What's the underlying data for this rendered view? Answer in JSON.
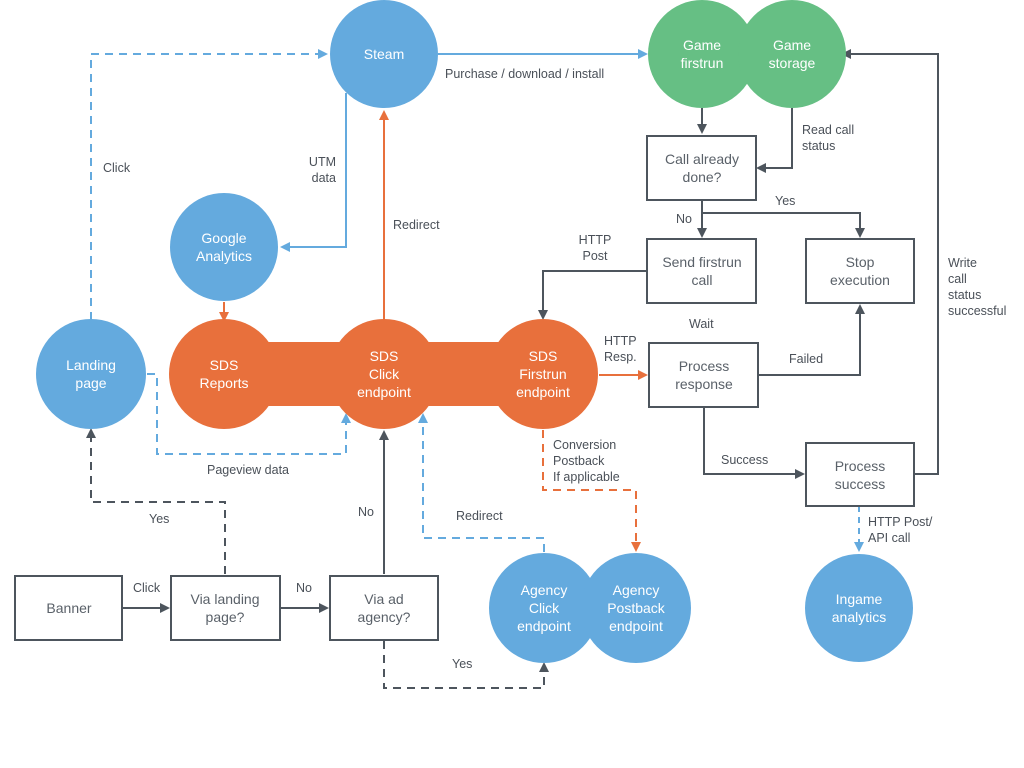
{
  "colors": {
    "blue": "#64aade",
    "orange": "#e8703c",
    "green": "#66bf84",
    "dark": "#4d555d"
  },
  "nodes": {
    "steam": [
      "Steam"
    ],
    "google_analytics": [
      "Google",
      "Analytics"
    ],
    "landing_page": [
      "Landing",
      "page"
    ],
    "sds_reports": [
      "SDS",
      "Reports"
    ],
    "sds_click": [
      "SDS",
      "Click",
      "endpoint"
    ],
    "sds_firstrun": [
      "SDS",
      "Firstrun",
      "endpoint"
    ],
    "game_firstrun": [
      "Game",
      "firstrun"
    ],
    "game_storage": [
      "Game",
      "storage"
    ],
    "agency_click": [
      "Agency",
      "Click",
      "endpoint"
    ],
    "agency_postback": [
      "Agency",
      "Postback",
      "endpoint"
    ],
    "ingame_analytics": [
      "Ingame",
      "analytics"
    ]
  },
  "boxes": {
    "call_already_done": [
      "Call already",
      "done?"
    ],
    "send_firstrun_call": [
      "Send firstrun",
      "call"
    ],
    "stop_execution": [
      "Stop",
      "execution"
    ],
    "process_response": [
      "Process",
      "response"
    ],
    "process_success": [
      "Process",
      "success"
    ],
    "banner": [
      "Banner"
    ],
    "via_landing_page": [
      "Via landing",
      "page?"
    ],
    "via_ad_agency": [
      "Via ad",
      "agency?"
    ]
  },
  "edge_labels": {
    "purchase": [
      "Purchase / download / install"
    ],
    "click_landing": [
      "Click"
    ],
    "utm_data": [
      "UTM",
      "data"
    ],
    "redirect_steam": [
      "Redirect"
    ],
    "read_call_status": [
      "Read call",
      "status"
    ],
    "no_call": [
      "No"
    ],
    "yes_call": [
      "Yes"
    ],
    "http_post": [
      "HTTP",
      "Post"
    ],
    "write_call_status": [
      "Write",
      "call",
      "status",
      "successful"
    ],
    "wait": [
      "Wait"
    ],
    "http_resp": [
      "HTTP",
      "Resp."
    ],
    "failed": [
      "Failed"
    ],
    "pageview_data": [
      "Pageview data"
    ],
    "conversion_postback": [
      "Conversion",
      "Postback",
      "If applicable"
    ],
    "success": [
      "Success"
    ],
    "yes_landing": [
      "Yes"
    ],
    "no_click": [
      "No"
    ],
    "redirect_agency": [
      "Redirect"
    ],
    "http_post_api": [
      "HTTP Post/",
      "API call"
    ],
    "click_banner": [
      "Click"
    ],
    "no_landing": [
      "No"
    ],
    "yes_agency": [
      "Yes"
    ]
  }
}
